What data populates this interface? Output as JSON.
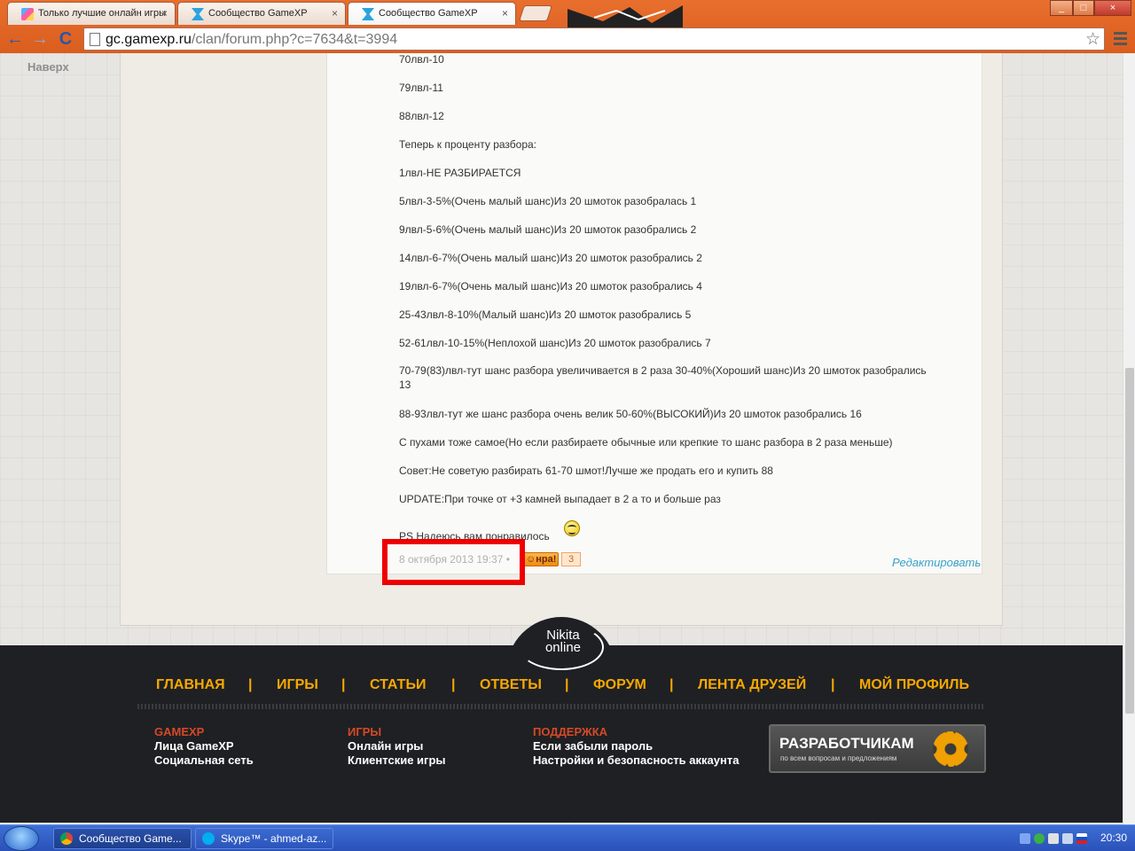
{
  "browser": {
    "tabs": [
      {
        "title": "Только лучшие онлайн игры",
        "active": false
      },
      {
        "title": "Сообщество GameXP",
        "active": false
      },
      {
        "title": "Сообщество GameXP",
        "active": true
      }
    ],
    "close_glyph": "×",
    "url_host": "gc.gamexp.ru",
    "url_path": "/clan/forum.php?c=7634&t=3994",
    "back_glyph": "←",
    "forward_glyph": "→",
    "reload_glyph": "C",
    "star_glyph": "☆",
    "window_buttons": {
      "minimize": "_",
      "maximize": "□",
      "close": "×"
    }
  },
  "page": {
    "scroll_up_label": "Наверх",
    "post_lines": [
      "70лвл-10",
      "79лвл-11",
      "88лвл-12",
      "Теперь к проценту разбора:",
      "1лвл-НЕ РАЗБИРАЕТСЯ",
      "5лвл-3-5%(Очень малый шанс)Из 20 шмоток разобралась 1",
      "9лвл-5-6%(Очень малый шанс)Из 20 шмоток разобрались 2",
      "14лвл-6-7%(Очень малый шанс)Из 20 шмоток разобрались 2",
      "19лвл-6-7%(Очень малый шанс)Из 20 шмоток разобрались 4",
      "25-43лвл-8-10%(Малый шанс)Из 20 шмоток разобрались 5",
      "52-61лвл-10-15%(Неплохой шанс)Из 20 шмоток разобрались 7",
      "70-79(83)лвл-тут шанс разбора увеличивается в 2 раза 30-40%(Хороший шанс)Из 20 шмоток разобрались 13",
      "88-93лвл-тут же шанс разбора очень велик 50-60%(ВЫСОКИЙ)Из 20 шмоток разобрались 16",
      "С пухами тоже самое(Но если разбираете обычные или крепкие то шанс разбора в 2 раза меньше)",
      "Совет:Не советую разбирать 61-70 шмот!Лучше же продать его и купить 88",
      "UPDATE:При точке от +3 камней выпадает в 2 а то и больше раз",
      "PS Надеюсь вам понравилось"
    ],
    "post_date": "8 октября 2013 19:37",
    "meta_sep": "•",
    "like_label": "☺нра!",
    "like_count": "3",
    "edit_label": "Редактировать"
  },
  "footer": {
    "logo_line1": "Nikita",
    "logo_line2": "online",
    "nav": [
      "ГЛАВНАЯ",
      "ИГРЫ",
      "СТАТЬИ",
      "ОТВЕТЫ",
      "ФОРУМ",
      "ЛЕНТА ДРУЗЕЙ",
      "МОЙ ПРОФИЛЬ"
    ],
    "nav_sep": "|",
    "col1": {
      "head": "GAMEXP",
      "items": [
        "Лица GameXP",
        "Социальная сеть"
      ]
    },
    "col2": {
      "head": "ИГРЫ",
      "items": [
        "Онлайн игры",
        "Клиентские игры"
      ]
    },
    "col3": {
      "head": "ПОДДЕРЖКА",
      "items": [
        "Если забыли пароль",
        "Настройки и безопасность аккаунта"
      ]
    },
    "dev_banner_title": "РАЗРАБОТЧИКАМ",
    "dev_banner_sub": "по всем вопросам и предложениям"
  },
  "taskbar": {
    "tasks": [
      {
        "label": "Сообщество Game...",
        "active": true
      },
      {
        "label": "Skype™ - ahmed-az...",
        "active": false
      }
    ],
    "clock": "20:30"
  },
  "colors": {
    "chrome_frame": "#e86f2e",
    "footer_nav": "#f7a800",
    "footer_head": "#d44a26",
    "highlight": "#ee0000",
    "edit_link": "#3aa0c8"
  }
}
